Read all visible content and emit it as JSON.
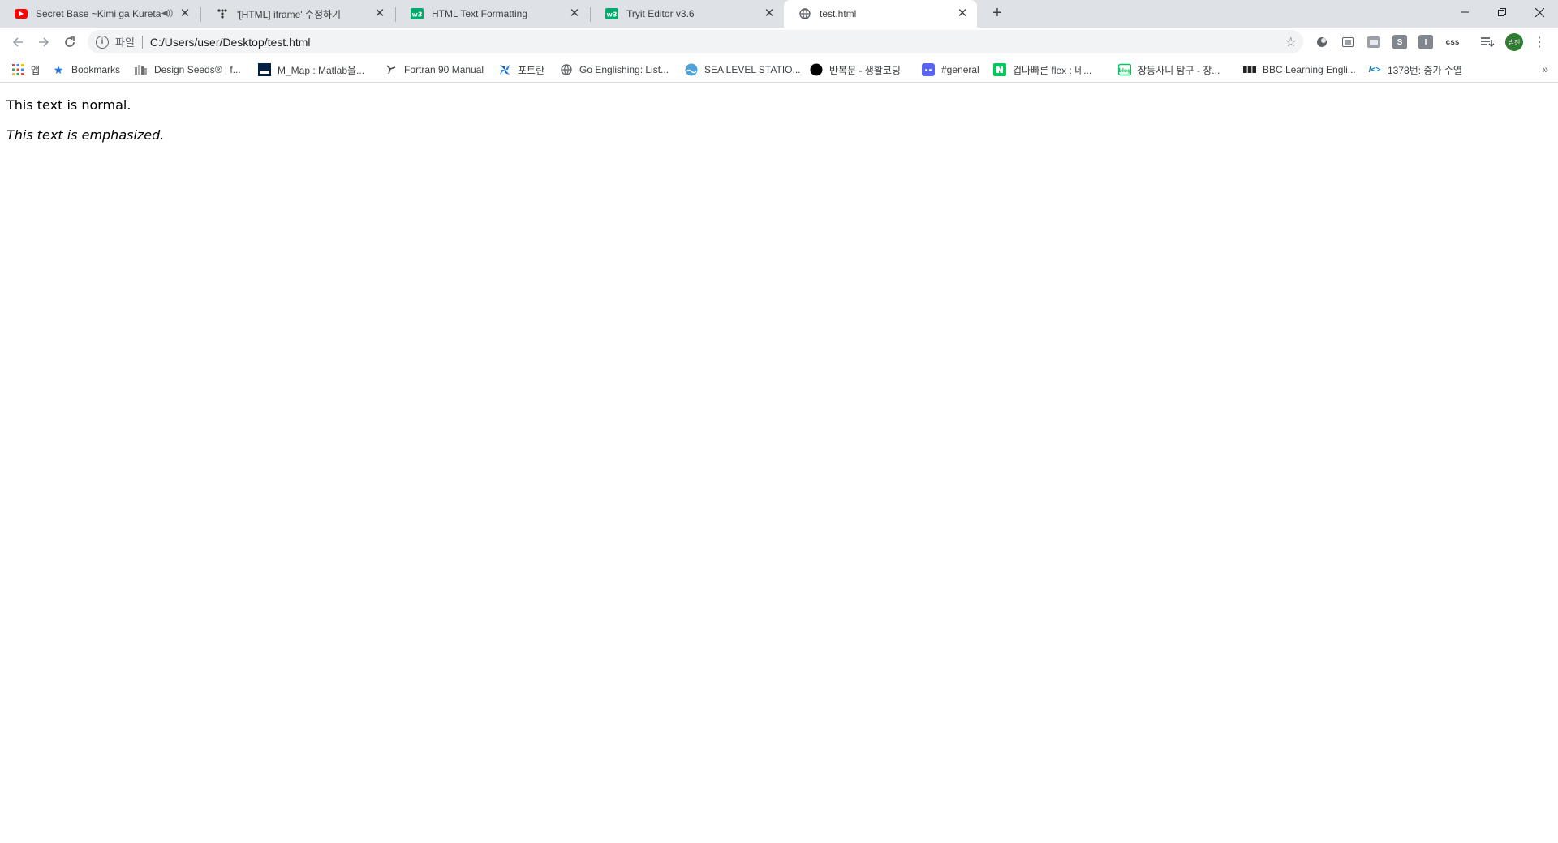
{
  "tabs": [
    {
      "title": "Secret Base ~Kimi ga Kureta",
      "favicon": "youtube-icon",
      "audio": true
    },
    {
      "title": "'[HTML] iframe' 수정하기",
      "favicon": "tistory-icon"
    },
    {
      "title": "HTML Text Formatting",
      "favicon": "w3schools-icon"
    },
    {
      "title": "Tryit Editor v3.6",
      "favicon": "w3schools-icon"
    },
    {
      "title": "test.html",
      "favicon": "globe-icon",
      "active": true
    }
  ],
  "toolbar": {
    "scheme": "파일",
    "url": "C:/Users/user/Desktop/test.html",
    "avatar_text": "범진"
  },
  "extensions": {
    "css": "css",
    "s": "S",
    "i": "I"
  },
  "bookmarks": [
    {
      "label": "앱",
      "icon": "apps-grid-icon"
    },
    {
      "label": "Bookmarks",
      "icon": "star-icon"
    },
    {
      "label": "Design Seeds® | f...",
      "icon": "design-seeds-icon"
    },
    {
      "label": "M_Map : Matlab을...",
      "icon": "ubc-icon"
    },
    {
      "label": "Fortran 90 Manual",
      "icon": "fortran-icon"
    },
    {
      "label": "포트란",
      "icon": "pinwheel-icon"
    },
    {
      "label": "Go Englishing: List...",
      "icon": "globe-icon"
    },
    {
      "label": "SEA LEVEL STATIO...",
      "icon": "sea-level-icon"
    },
    {
      "label": "반복문 - 생활코딩",
      "icon": "circle-icon"
    },
    {
      "label": "#general",
      "icon": "discord-icon"
    },
    {
      "label": "겁나빠른 flex : 네...",
      "icon": "naver-icon"
    },
    {
      "label": "장동사니 탐구 - 장...",
      "icon": "blog-icon"
    },
    {
      "label": "BBC Learning Engli...",
      "icon": "bbc-icon"
    },
    {
      "label": "1378번: 증가 수열",
      "icon": "code-icon"
    }
  ],
  "colors": {
    "tabstrip": "#dee1e6",
    "youtube": "#ff0000",
    "w3schools": "#04aa6d",
    "avatar": "#2e7d32",
    "naver": "#03c75a",
    "discord": "#5865f2"
  },
  "page": {
    "normal_text": "This text is normal.",
    "emphasized_text": "This text is emphasized."
  }
}
